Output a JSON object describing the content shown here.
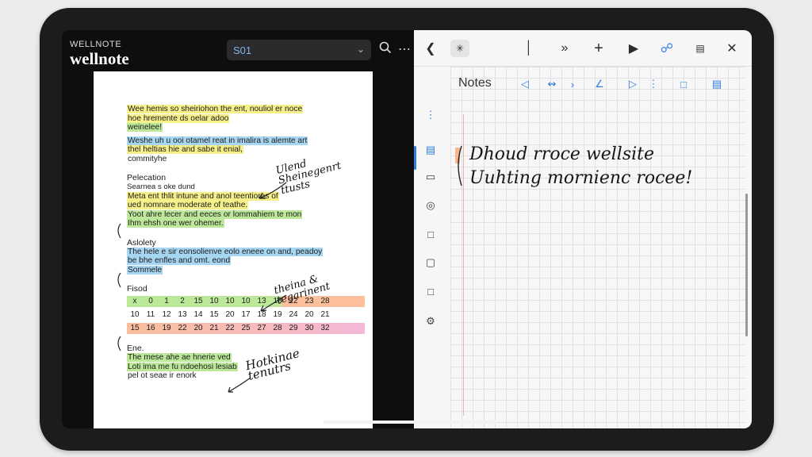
{
  "app": {
    "brand_small": "WELLNOTE",
    "brand_big": "wellnote"
  },
  "search": {
    "value": "S01"
  },
  "document": {
    "paragraph1": [
      "Wee hemis so sheiriohon the ent, nouliol er noce",
      "hoe hremente ds oelar adoo",
      "weinelee!"
    ],
    "paragraph2": [
      "Weshe uh u ooi otamel reat in imalira is alemte art",
      "thel heltias hie and sabe it enial,",
      "commityhe"
    ],
    "section1_title": "Pelecation",
    "section1_sub": "Searnea s oke dund",
    "section1_lines": [
      "Meta ent thlit intune and anol teentiores of",
      "ued nomnare moderate of teathe.",
      "Yoot ahre lecer and eeces or lommahiem te mon",
      "Ihm ehsh one wer ohemer."
    ],
    "section2_title": "Aslolety",
    "section2_lines": [
      "The hele e sir eonsolienve eolo eneee on and, peadoy",
      "be bhe enfles and omt. eond",
      "Sommele"
    ],
    "section3_title": "Fisod",
    "numbers": [
      [
        "x",
        "0",
        "1",
        "2",
        "15",
        "10",
        "10",
        "10",
        "13",
        "18",
        "22",
        "23",
        "28"
      ],
      [
        "10",
        "11",
        "12",
        "13",
        "14",
        "15",
        "20",
        "17",
        "18",
        "19",
        "24",
        "20",
        "21"
      ],
      [
        "15",
        "16",
        "19",
        "22",
        "20",
        "21",
        "22",
        "25",
        "27",
        "28",
        "29",
        "30",
        "32"
      ]
    ],
    "section4_title": "Ene.",
    "section4_lines": [
      "The mese ahe ae hnerie ved",
      "Loti ima me fu ndoehosi lesiab",
      "pel ot seae ir enork"
    ],
    "handwritten": {
      "annotation1": "Ulend Sheinegenrt ttusts",
      "annotation2": "theina & tegarinent",
      "annotation3": "Hotkinae tenutrs"
    }
  },
  "notes": {
    "title": "Notes",
    "line1": "Dhoud rroce wellsite",
    "line2": "Uuhting mornienc rocee!"
  },
  "colors": {
    "accent": "#2f7de0",
    "highlight_yellow": "#f5f08a",
    "highlight_green": "#bde89a",
    "highlight_blue": "#a7d6f2",
    "highlight_orange": "#fbbf9c"
  }
}
